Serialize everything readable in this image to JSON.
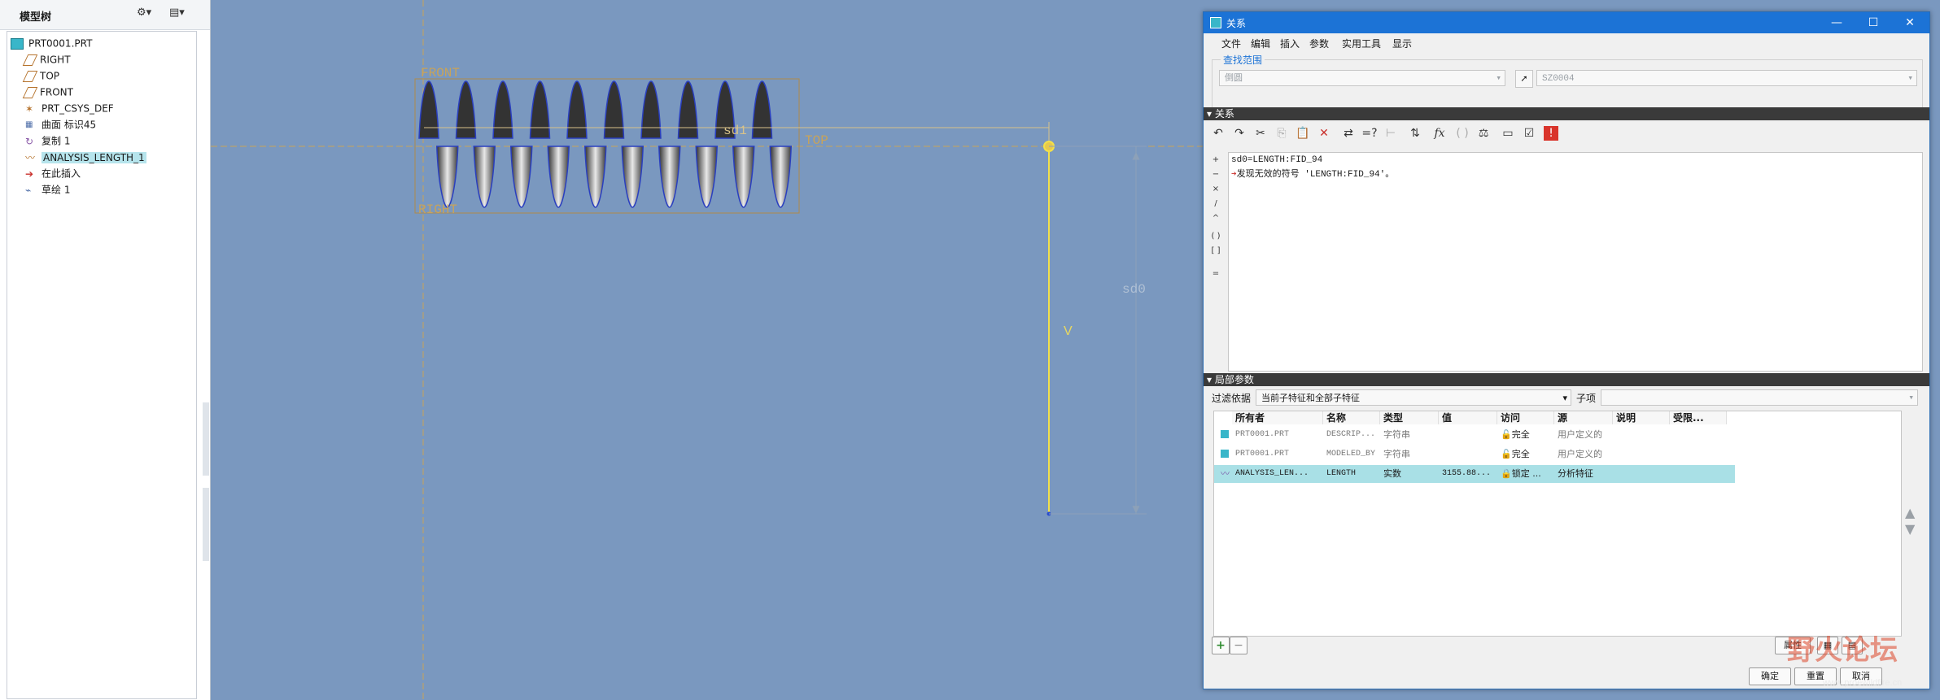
{
  "model_tree": {
    "title": "模型树",
    "items": [
      {
        "label": "PRT0001.PRT",
        "icon": "part-icon"
      },
      {
        "label": "RIGHT",
        "icon": "datum-plane-icon"
      },
      {
        "label": "TOP",
        "icon": "datum-plane-icon"
      },
      {
        "label": "FRONT",
        "icon": "datum-plane-icon"
      },
      {
        "label": "PRT_CSYS_DEF",
        "icon": "csys-icon"
      },
      {
        "label": "曲面 标识45",
        "icon": "surface-icon"
      },
      {
        "label": "复制 1",
        "icon": "copy-icon"
      },
      {
        "label": "ANALYSIS_LENGTH_1",
        "icon": "analysis-icon"
      },
      {
        "label": "在此插入",
        "icon": "insert-arrow-icon"
      },
      {
        "label": "草绘 1",
        "icon": "sketch-icon"
      }
    ]
  },
  "graphics": {
    "labels": {
      "front": "FRONT",
      "top": "TOP",
      "right": "RIGHT",
      "sd1": "sd1",
      "sd0": "sd0",
      "v": "V"
    },
    "colors": {
      "background": "#7a98bf",
      "datum": "#c8a35a",
      "coil": "#3a3a3a"
    }
  },
  "dialog": {
    "title": "关系",
    "window_controls": [
      "—",
      "☐",
      "✕"
    ],
    "menu": [
      "文件",
      "编辑",
      "插入",
      "参数",
      "实用工具",
      "显示"
    ],
    "search_scope": {
      "label": "查找范围",
      "scope_value": "倒圆",
      "feature_value": "SZ0004"
    },
    "relations": {
      "label": "关系",
      "ops": [
        "+",
        "−",
        "×",
        "/",
        "^",
        "( )",
        "[ ]",
        "="
      ],
      "lines": [
        "sd0=LENGTH:FID_94",
        "发现无效的符号 'LENGTH:FID_94'。"
      ]
    },
    "local_params": {
      "label": "局部参数",
      "filter_label": "过滤依据",
      "filter_value": "当前子特征和全部子特征",
      "child_label": "子项",
      "columns": [
        "所有者",
        "名称",
        "类型",
        "值",
        "访问",
        "源",
        "说明",
        "受限..."
      ],
      "rows": [
        {
          "owner": "PRT0001.PRT",
          "name": "DESCRIP...",
          "type": "字符串",
          "value": "",
          "access": "完全",
          "source": "用户定义的",
          "desc": "",
          "restricted": "",
          "selected": false
        },
        {
          "owner": "PRT0001.PRT",
          "name": "MODELED_BY",
          "type": "字符串",
          "value": "",
          "access": "完全",
          "source": "用户定义的",
          "desc": "",
          "restricted": "",
          "selected": false
        },
        {
          "owner": "ANALYSIS_LEN...",
          "name": "LENGTH",
          "type": "实数",
          "value": "3155.88...",
          "access": "锁定 ...",
          "source": "分析特征",
          "desc": "",
          "restricted": "",
          "selected": true
        }
      ]
    },
    "buttons": {
      "properties": "属性",
      "ok": "确定",
      "reset": "重置",
      "cancel": "取消"
    }
  },
  "watermark": {
    "text": "野火论坛",
    "url": "www.proewildfire.cn"
  }
}
